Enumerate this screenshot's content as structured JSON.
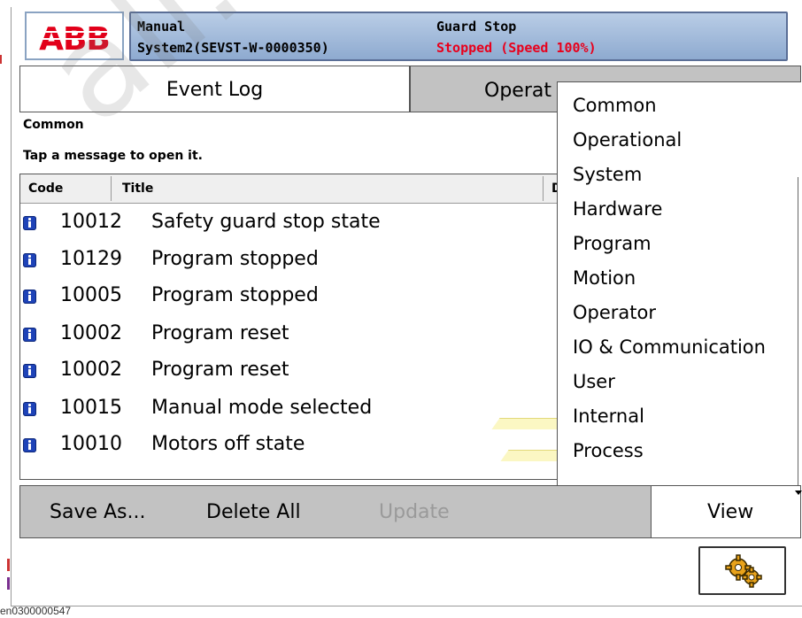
{
  "header": {
    "logo_text": "ABB",
    "mode": "Manual",
    "system": "System2(SEVST-W-0000350)",
    "state": "Guard Stop",
    "speed_status": "Stopped (Speed 100%)",
    "speed_color": "#e8001c"
  },
  "tabs": [
    {
      "label": "Event Log",
      "active": true
    },
    {
      "label": "Operat",
      "active": false
    }
  ],
  "log": {
    "category": "Common",
    "instruction": "Tap a message to open it.",
    "columns": [
      "Code",
      "Title",
      "D"
    ],
    "rows": [
      {
        "icon": "info-icon",
        "code": "10012",
        "title": "Safety guard stop state"
      },
      {
        "icon": "info-icon",
        "code": "10129",
        "title": "Program stopped"
      },
      {
        "icon": "info-icon",
        "code": "10005",
        "title": "Program stopped"
      },
      {
        "icon": "info-icon",
        "code": "10002",
        "title": "Program reset"
      },
      {
        "icon": "info-icon",
        "code": "10002",
        "title": "Program reset"
      },
      {
        "icon": "info-icon",
        "code": "10015",
        "title": "Manual mode selected"
      },
      {
        "icon": "info-icon",
        "code": "10010",
        "title": "Motors off state"
      }
    ]
  },
  "toolbar": {
    "save_as": "Save As...",
    "delete_all": "Delete All",
    "update": "Update",
    "view": "View"
  },
  "view_menu": {
    "items": [
      "Common",
      "Operational",
      "System",
      "Hardware",
      "Program",
      "Motion",
      "Operator",
      "IO & Communication",
      "User",
      "Internal",
      "Process"
    ]
  },
  "quickset": {
    "icon": "gears-icon"
  },
  "watermark": "all. sales",
  "footer_id": "en0300000547",
  "colors": {
    "status_panel": "#9fb8da",
    "toolbar": "#c2c2c2",
    "info_icon": "#1e43b8"
  }
}
